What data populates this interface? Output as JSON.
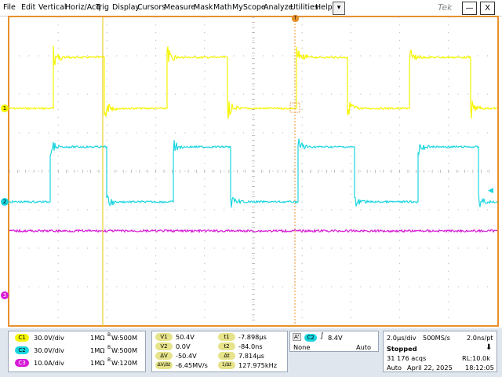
{
  "menu": {
    "items": [
      "File",
      "Edit",
      "Vertical",
      "Horiz/Acq",
      "Trig",
      "Display",
      "Cursors",
      "Measure",
      "Mask",
      "Math",
      "MyScope",
      "Analyze",
      "Utilities",
      "Help"
    ],
    "dropdown_glyph": "▾",
    "logo": "Tek",
    "minimize": "—",
    "close": "X"
  },
  "markers": {
    "ch1": "1",
    "ch2": "2",
    "ch3": "3",
    "trigger_top": "T",
    "ch2_level_arrow": "◀"
  },
  "colors": {
    "ch1": "#f5f500",
    "ch2": "#1ad5e0",
    "ch3": "#d61ad6",
    "grid_border": "#e8912c",
    "cursor": "#e8c400"
  },
  "channels": [
    {
      "id": "C1",
      "scale": "30.0V/div",
      "impedance": "1MΩ",
      "bw_prefix": "B",
      "bw": "W:500M",
      "color": "#f5f500"
    },
    {
      "id": "C2",
      "scale": "30.0V/div",
      "impedance": "1MΩ",
      "bw_prefix": "B",
      "bw": "W:500M",
      "color": "#1ad5e0"
    },
    {
      "id": "C3",
      "scale": "10.0A/div",
      "impedance": "1MΩ",
      "bw_prefix": "B",
      "bw": "W:120M",
      "color": "#d61ad6"
    }
  ],
  "cursors": {
    "left": [
      {
        "label": "V1",
        "value": "50.4V"
      },
      {
        "label": "V2",
        "value": "0.0V"
      },
      {
        "label": "ΔV",
        "value": "-50.4V"
      },
      {
        "label": "ΔV/Δt",
        "value": "-6.45MV/s"
      }
    ],
    "right": [
      {
        "label": "t1",
        "value": "-7.898µs"
      },
      {
        "label": "t2",
        "value": "-84.0ns"
      },
      {
        "label": "Δt",
        "value": "7.814µs"
      },
      {
        "label": "1/Δt",
        "value": "127.975kHz"
      }
    ]
  },
  "trigger": {
    "label_a": "A'",
    "channel": "C2",
    "slope": "∫",
    "level": "8.4V",
    "coupling": "None",
    "mode": "Auto"
  },
  "acquisition": {
    "horiz_scale": "2.0µs/div",
    "sample_rate": "500MS/s",
    "resolution": "2.0ns/pt",
    "state": "Stopped",
    "acqs": "31 176 acqs",
    "record_length": "RL:10.0k",
    "mode": "Auto",
    "date": "April 22, 2025",
    "time": "18:12:05"
  }
}
